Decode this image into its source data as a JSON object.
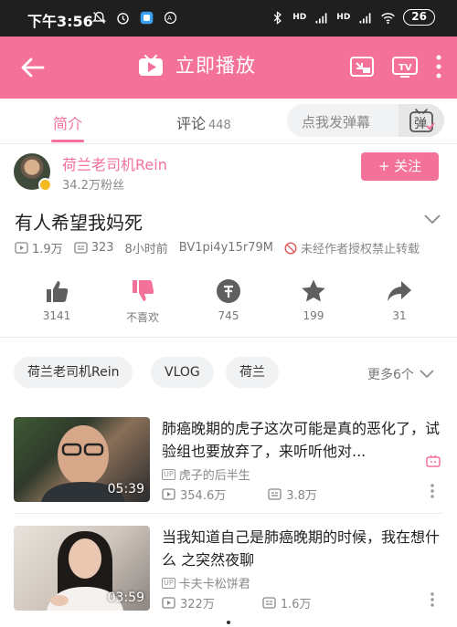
{
  "status_bar": {
    "time": "下午3:56",
    "signal_1": "HD",
    "signal_2": "HD",
    "battery": "26"
  },
  "app_bar": {
    "title": "立即播放"
  },
  "tabs": [
    {
      "label": "简介"
    },
    {
      "label": "评论",
      "count": "448"
    }
  ],
  "danmaku": {
    "placeholder": "点我发弹幕",
    "button": "弹"
  },
  "uploader": {
    "name": "荷兰老司机Rein",
    "fans": "34.2万粉丝",
    "follow": "+ 关注"
  },
  "video": {
    "title": "有人希望我妈死",
    "views": "1.9万",
    "danmaku_count": "323",
    "time_ago": "8小时前",
    "bvid": "BV1pi4y15r79M",
    "notice": "未经作者授权禁止转载"
  },
  "actions": [
    {
      "name": "like",
      "count": "3141"
    },
    {
      "name": "dislike",
      "count": "不喜欢"
    },
    {
      "name": "coin",
      "count": "745"
    },
    {
      "name": "favorite",
      "count": "199"
    },
    {
      "name": "share",
      "count": "31"
    }
  ],
  "tags": [
    "荷兰老司机Rein",
    "VLOG",
    "荷兰"
  ],
  "more_tags": "更多6个",
  "recommended": [
    {
      "title": "肺癌晚期的虎子这次可能是真的恶化了，试验组也要放弃了，来听听他对...",
      "uploader": "虎子的后半生",
      "duration": "05:39",
      "views": "354.6万",
      "danmaku": "3.8万"
    },
    {
      "title": "当我知道自己是肺癌晚期的时候，我在想什么 之突然夜聊",
      "uploader": "卡夫卡松饼君",
      "duration": "03:59",
      "views": "322万",
      "danmaku": "1.6万"
    }
  ],
  "colors": {
    "accent": "#f4729a",
    "status_bar": "#1f1f1f"
  }
}
